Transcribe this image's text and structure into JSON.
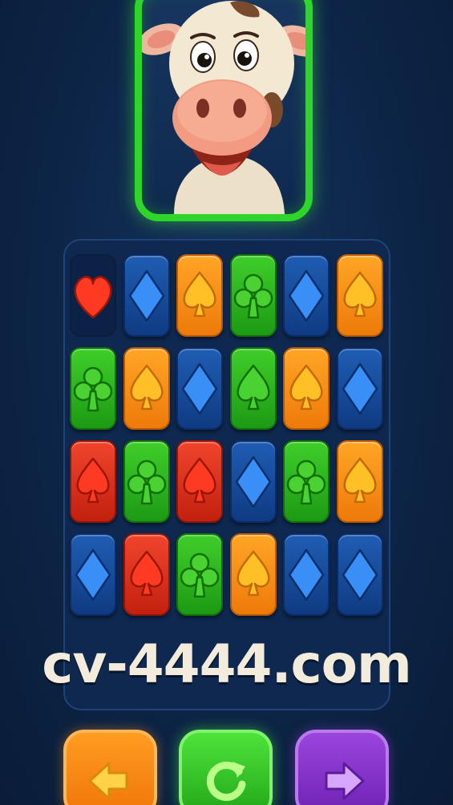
{
  "watermark": "cv-4444.com",
  "character": {
    "name": "cow-mascot"
  },
  "board": {
    "rows": [
      [
        {
          "suit": "heart",
          "color": "red"
        },
        {
          "suit": "diamond",
          "color": "blue"
        },
        {
          "suit": "spade",
          "color": "orange"
        },
        {
          "suit": "club",
          "color": "green"
        },
        {
          "suit": "diamond",
          "color": "blue"
        },
        {
          "suit": "spade",
          "color": "orange"
        }
      ],
      [
        {
          "suit": "club",
          "color": "green"
        },
        {
          "suit": "spade",
          "color": "orange"
        },
        {
          "suit": "diamond",
          "color": "blue"
        },
        {
          "suit": "spade",
          "color": "green"
        },
        {
          "suit": "spade",
          "color": "orange"
        },
        {
          "suit": "diamond",
          "color": "blue"
        }
      ],
      [
        {
          "suit": "spade",
          "color": "red"
        },
        {
          "suit": "club",
          "color": "green"
        },
        {
          "suit": "spade",
          "color": "red"
        },
        {
          "suit": "diamond",
          "color": "blue"
        },
        {
          "suit": "club",
          "color": "green"
        },
        {
          "suit": "spade",
          "color": "orange"
        }
      ],
      [
        {
          "suit": "diamond",
          "color": "blue"
        },
        {
          "suit": "spade",
          "color": "red"
        },
        {
          "suit": "club",
          "color": "green"
        },
        {
          "suit": "spade",
          "color": "orange"
        },
        {
          "suit": "diamond",
          "color": "blue"
        },
        {
          "suit": "diamond",
          "color": "blue"
        }
      ]
    ]
  },
  "controls": [
    {
      "name": "back-button",
      "icon": "arrow-left-icon",
      "color": "#f58a12"
    },
    {
      "name": "refresh-button",
      "icon": "refresh-icon",
      "color": "#2fbf24"
    },
    {
      "name": "forward-button",
      "icon": "arrow-right-icon",
      "color": "#8a36cf"
    }
  ],
  "colors": {
    "background": "#0d2547",
    "frame_green": "#2fd62a",
    "red": "#e2351f",
    "blue": "#2a7ef0",
    "orange": "#ffb41e",
    "green": "#2fc023"
  }
}
